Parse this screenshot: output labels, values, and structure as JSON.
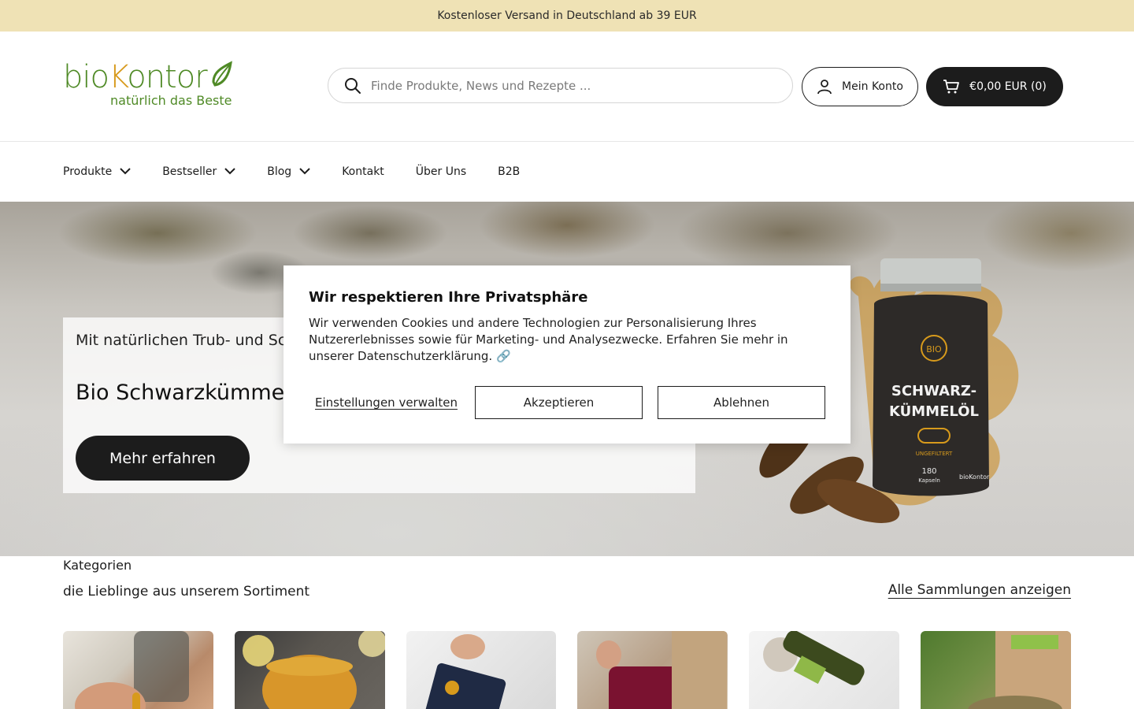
{
  "announcement": "Kostenloser Versand in Deutschland ab 39 EUR",
  "logo": {
    "brand_prefix": "bio",
    "brand_k": "K",
    "brand_rest": "ontor",
    "tagline": "natürlich das Beste"
  },
  "search": {
    "placeholder": "Finde Produkte, News und Rezepte ..."
  },
  "account": {
    "label": "Mein Konto"
  },
  "cart": {
    "label": "€0,00 EUR (0)"
  },
  "nav": {
    "items": [
      {
        "label": "Produkte",
        "has_dropdown": true
      },
      {
        "label": "Bestseller",
        "has_dropdown": true
      },
      {
        "label": "Blog",
        "has_dropdown": true
      },
      {
        "label": "Kontakt",
        "has_dropdown": false
      },
      {
        "label": "Über Uns",
        "has_dropdown": false
      },
      {
        "label": "B2B",
        "has_dropdown": false
      }
    ]
  },
  "hero": {
    "subtitle": "Mit natürlichen Trub- und Sch",
    "title": "Bio Schwarzkümmelö",
    "cta": "Mehr erfahren",
    "product": {
      "line1": "SCHWARZ-",
      "line2": "KÜMMELÖL",
      "badge": "BIO",
      "note": "UNGEFILTERT",
      "count": "180",
      "count_unit": "Kapseln",
      "brand": "bioKontor"
    }
  },
  "categories": {
    "heading": "Kategorien",
    "subheading": "die Lieblinge aus unserem Sortiment",
    "view_all": "Alle Sammlungen anzeigen"
  },
  "cookie": {
    "title": "Wir respektieren Ihre Privatsphäre",
    "text": "Wir verwenden Cookies und andere Technologien zur Personalisierung Ihres Nutzererlebnisses sowie für Marketing- und Analysezwecke. Erfahren Sie mehr in unserer Datenschutzerklärung.",
    "link_icon": "🔗",
    "manage": "Einstellungen verwalten",
    "accept": "Akzeptieren",
    "decline": "Ablehnen"
  },
  "colors": {
    "announcement_bg": "#efe2b5",
    "brand_green": "#4f8a26",
    "brand_orange": "#d79a1c",
    "dark": "#1c1c1c"
  }
}
